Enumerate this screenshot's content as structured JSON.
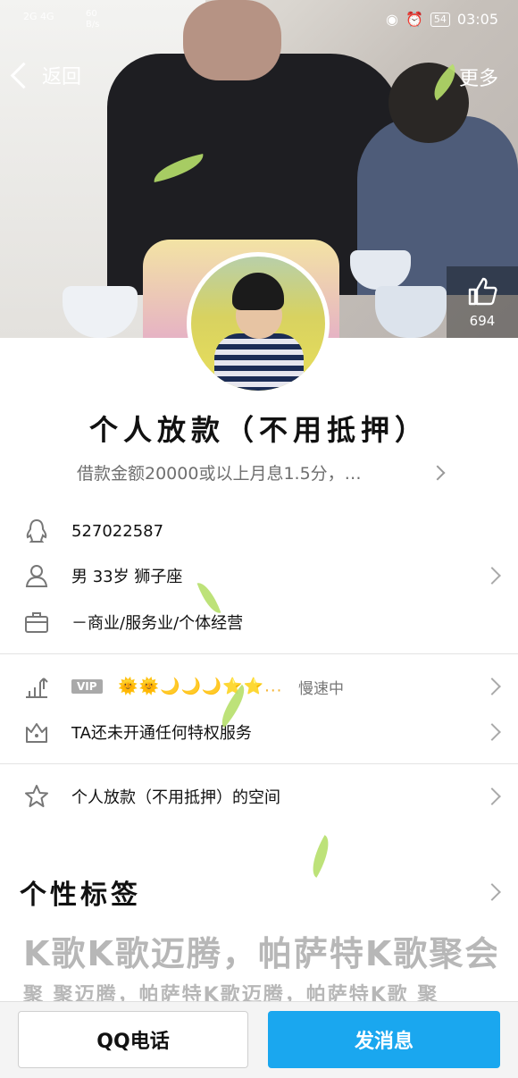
{
  "status_bar": {
    "network": "2G 4G",
    "speed": "60\nB/s",
    "battery": "54",
    "time": "03:05"
  },
  "nav": {
    "back_label": "返回",
    "more_label": "更多"
  },
  "like": {
    "count": "694"
  },
  "profile": {
    "name": "个人放款（不用抵押）",
    "signature": "借款金额20000或以上月息1.5分，…"
  },
  "info": {
    "qq": "527022587",
    "person": "男  33岁  狮子座",
    "job": "－商业/服务业/个体经营"
  },
  "vip": {
    "badge": "VIP",
    "icons": "🌞🌞🌙🌙🌙⭐⭐...",
    "status": "慢速中",
    "privilege": "TA还未开通任何特权服务"
  },
  "space": {
    "label": "个人放款（不用抵押）的空间"
  },
  "tags_section": {
    "title": "个性标签",
    "line1": "K歌K歌迈腾，帕萨特K歌聚会",
    "line2": "聚 聚迈腾，帕萨特K歌迈腾，帕萨特K歌 聚"
  },
  "actions": {
    "call_label": "QQ电话",
    "message_label": "发消息"
  }
}
